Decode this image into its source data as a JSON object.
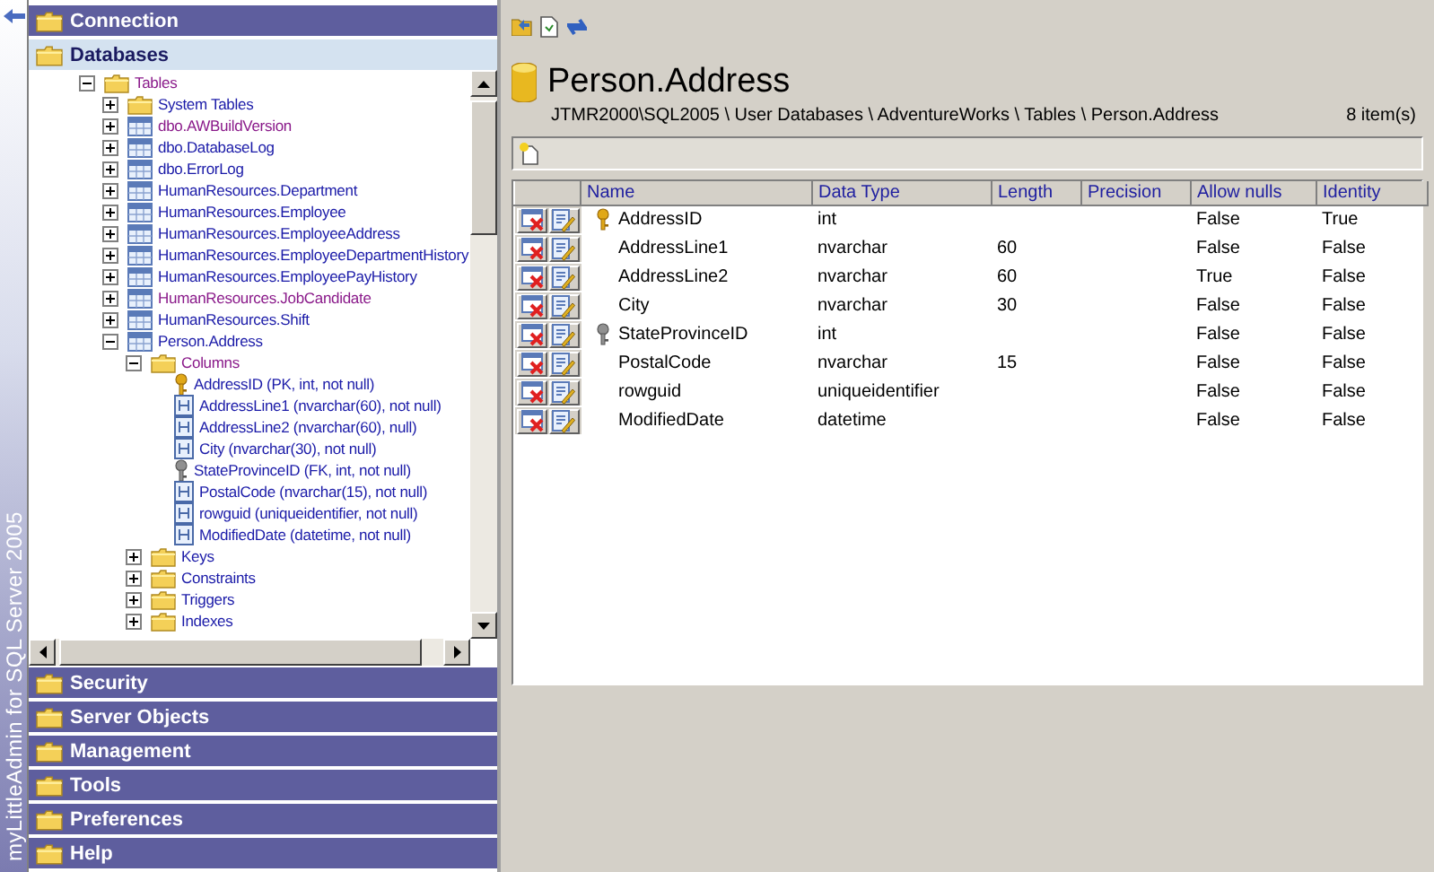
{
  "sidebar": {
    "brand": "myLittleAdmin for SQL Server 2005",
    "sections_top": [
      {
        "label": "Connection",
        "selected": false
      },
      {
        "label": "Databases",
        "selected": true
      }
    ],
    "tree": [
      {
        "label": "Tables",
        "kind": "folder",
        "expanded": true,
        "visited": true,
        "children": [
          {
            "label": "System Tables",
            "kind": "folder",
            "expanded": false,
            "visited": false
          },
          {
            "label": "dbo.AWBuildVersion",
            "kind": "table",
            "expanded": false,
            "visited": true
          },
          {
            "label": "dbo.DatabaseLog",
            "kind": "table",
            "expanded": false,
            "visited": false
          },
          {
            "label": "dbo.ErrorLog",
            "kind": "table",
            "expanded": false,
            "visited": false
          },
          {
            "label": "HumanResources.Department",
            "kind": "table",
            "expanded": false,
            "visited": false
          },
          {
            "label": "HumanResources.Employee",
            "kind": "table",
            "expanded": false,
            "visited": false
          },
          {
            "label": "HumanResources.EmployeeAddress",
            "kind": "table",
            "expanded": false,
            "visited": false
          },
          {
            "label": "HumanResources.EmployeeDepartmentHistory",
            "kind": "table",
            "expanded": false,
            "visited": false
          },
          {
            "label": "HumanResources.EmployeePayHistory",
            "kind": "table",
            "expanded": false,
            "visited": false
          },
          {
            "label": "HumanResources.JobCandidate",
            "kind": "table",
            "expanded": false,
            "visited": true
          },
          {
            "label": "HumanResources.Shift",
            "kind": "table",
            "expanded": false,
            "visited": false
          },
          {
            "label": "Person.Address",
            "kind": "table",
            "expanded": true,
            "visited": false,
            "children": [
              {
                "label": "Columns",
                "kind": "folder",
                "expanded": true,
                "visited": true,
                "children": [
                  {
                    "label": "AddressID (PK, int, not null)",
                    "kind": "pk",
                    "visited": false
                  },
                  {
                    "label": "AddressLine1 (nvarchar(60), not null)",
                    "kind": "column",
                    "visited": false
                  },
                  {
                    "label": "AddressLine2 (nvarchar(60), null)",
                    "kind": "column",
                    "visited": false
                  },
                  {
                    "label": "City (nvarchar(30), not null)",
                    "kind": "column",
                    "visited": false
                  },
                  {
                    "label": "StateProvinceID (FK, int, not null)",
                    "kind": "fk",
                    "visited": false
                  },
                  {
                    "label": "PostalCode (nvarchar(15), not null)",
                    "kind": "column",
                    "visited": false
                  },
                  {
                    "label": "rowguid (uniqueidentifier, not null)",
                    "kind": "column",
                    "visited": false
                  },
                  {
                    "label": "ModifiedDate (datetime, not null)",
                    "kind": "column",
                    "visited": false
                  }
                ]
              },
              {
                "label": "Keys",
                "kind": "folder",
                "expanded": false,
                "visited": false
              },
              {
                "label": "Constraints",
                "kind": "folder",
                "expanded": false,
                "visited": false
              },
              {
                "label": "Triggers",
                "kind": "folder",
                "expanded": false,
                "visited": false
              },
              {
                "label": "Indexes",
                "kind": "folder",
                "expanded": false,
                "visited": false
              }
            ]
          }
        ]
      }
    ],
    "sections_bottom": [
      {
        "label": "Security",
        "selected": false
      },
      {
        "label": "Server Objects",
        "selected": false
      },
      {
        "label": "Management",
        "selected": false
      },
      {
        "label": "Tools",
        "selected": false
      },
      {
        "label": "Preferences",
        "selected": false
      },
      {
        "label": "Help",
        "selected": false
      }
    ]
  },
  "main": {
    "title": "Person.Address",
    "breadcrumb": "JTMR2000\\SQL2005 \\ User Databases \\ AdventureWorks \\ Tables \\ Person.Address",
    "count": "8 item(s)",
    "table": {
      "columns": [
        "Name",
        "Data Type",
        "Length",
        "Precision",
        "Allow nulls",
        "Identity"
      ],
      "rows": [
        {
          "kind": "primary",
          "cells": [
            "AddressID",
            "int",
            "",
            "",
            "False",
            "True"
          ]
        },
        {
          "kind": "plain",
          "cells": [
            "AddressLine1",
            "nvarchar",
            "60",
            "",
            "False",
            "False"
          ]
        },
        {
          "kind": "plain",
          "cells": [
            "AddressLine2",
            "nvarchar",
            "60",
            "",
            "True",
            "False"
          ]
        },
        {
          "kind": "plain",
          "cells": [
            "City",
            "nvarchar",
            "30",
            "",
            "False",
            "False"
          ]
        },
        {
          "kind": "foreign",
          "cells": [
            "StateProvinceID",
            "int",
            "",
            "",
            "False",
            "False"
          ]
        },
        {
          "kind": "plain",
          "cells": [
            "PostalCode",
            "nvarchar",
            "15",
            "",
            "False",
            "False"
          ]
        },
        {
          "kind": "plain",
          "cells": [
            "rowguid",
            "uniqueidentifier",
            "",
            "",
            "False",
            "False"
          ]
        },
        {
          "kind": "plain",
          "cells": [
            "ModifiedDate",
            "datetime",
            "",
            "",
            "False",
            "False"
          ]
        }
      ]
    }
  }
}
